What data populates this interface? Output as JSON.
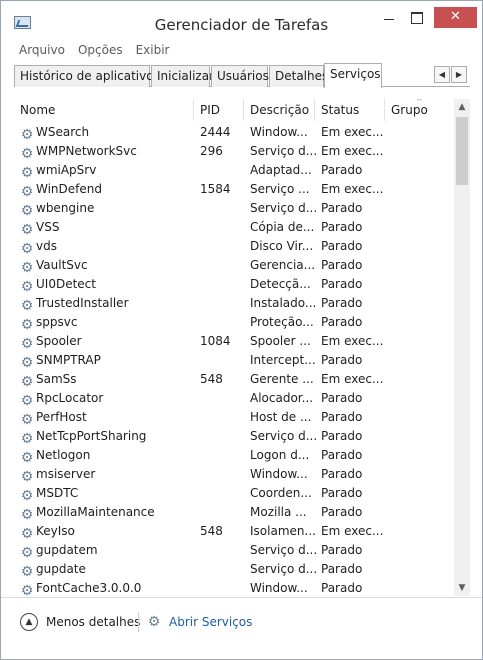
{
  "window": {
    "title": "Gerenciador de Tarefas",
    "close_glyph": "✕"
  },
  "menu": [
    "Arquivo",
    "Opções",
    "Exibir"
  ],
  "tabs": [
    {
      "label": "Histórico de aplicativos",
      "active": false
    },
    {
      "label": "Inicializar",
      "active": false
    },
    {
      "label": "Usuários",
      "active": false
    },
    {
      "label": "Detalhes",
      "active": false
    },
    {
      "label": "Serviços",
      "active": true
    }
  ],
  "tab_scroll": {
    "left": "◀",
    "right": "▶"
  },
  "columns": {
    "name": "Nome",
    "pid": "PID",
    "description": "Descrição",
    "status": "Status",
    "group": "Grupo"
  },
  "sort_indicator": "^",
  "services": [
    {
      "name": "WSearch",
      "pid": "2444",
      "description": "Window...",
      "status": "Em exec..."
    },
    {
      "name": "WMPNetworkSvc",
      "pid": "296",
      "description": "Serviço d...",
      "status": "Em exec..."
    },
    {
      "name": "wmiApSrv",
      "pid": "",
      "description": "Adaptad...",
      "status": "Parado"
    },
    {
      "name": "WinDefend",
      "pid": "1584",
      "description": "Serviço ...",
      "status": "Em exec..."
    },
    {
      "name": "wbengine",
      "pid": "",
      "description": "Serviço d...",
      "status": "Parado"
    },
    {
      "name": "VSS",
      "pid": "",
      "description": "Cópia de...",
      "status": "Parado"
    },
    {
      "name": "vds",
      "pid": "",
      "description": "Disco Vir...",
      "status": "Parado"
    },
    {
      "name": "VaultSvc",
      "pid": "",
      "description": "Gerencia...",
      "status": "Parado"
    },
    {
      "name": "UI0Detect",
      "pid": "",
      "description": "Detecçã...",
      "status": "Parado"
    },
    {
      "name": "TrustedInstaller",
      "pid": "",
      "description": "Instalado...",
      "status": "Parado"
    },
    {
      "name": "sppsvc",
      "pid": "",
      "description": "Proteção...",
      "status": "Parado"
    },
    {
      "name": "Spooler",
      "pid": "1084",
      "description": "Spooler ...",
      "status": "Em exec..."
    },
    {
      "name": "SNMPTRAP",
      "pid": "",
      "description": "Intercept...",
      "status": "Parado"
    },
    {
      "name": "SamSs",
      "pid": "548",
      "description": "Gerente ...",
      "status": "Em exec..."
    },
    {
      "name": "RpcLocator",
      "pid": "",
      "description": "Alocador...",
      "status": "Parado"
    },
    {
      "name": "PerfHost",
      "pid": "",
      "description": "Host de ...",
      "status": "Parado"
    },
    {
      "name": "NetTcpPortSharing",
      "pid": "",
      "description": "Serviço d...",
      "status": "Parado"
    },
    {
      "name": "Netlogon",
      "pid": "",
      "description": "Logon d...",
      "status": "Parado"
    },
    {
      "name": "msiserver",
      "pid": "",
      "description": "Window...",
      "status": "Parado"
    },
    {
      "name": "MSDTC",
      "pid": "",
      "description": "Coorden...",
      "status": "Parado"
    },
    {
      "name": "MozillaMaintenance",
      "pid": "",
      "description": "Mozilla ...",
      "status": "Parado"
    },
    {
      "name": "KeyIso",
      "pid": "548",
      "description": "Isolamen...",
      "status": "Em exec..."
    },
    {
      "name": "gupdatem",
      "pid": "",
      "description": "Serviço d...",
      "status": "Parado"
    },
    {
      "name": "gupdate",
      "pid": "",
      "description": "Serviço d...",
      "status": "Parado"
    },
    {
      "name": "FontCache3.0.0.0",
      "pid": "",
      "description": "Window...",
      "status": "Parado"
    }
  ],
  "footer": {
    "less_details": "Menos detalhes",
    "open_services": "Abrir Serviços"
  },
  "icons": {
    "service": "gear-icon",
    "app": "task-manager-icon"
  }
}
